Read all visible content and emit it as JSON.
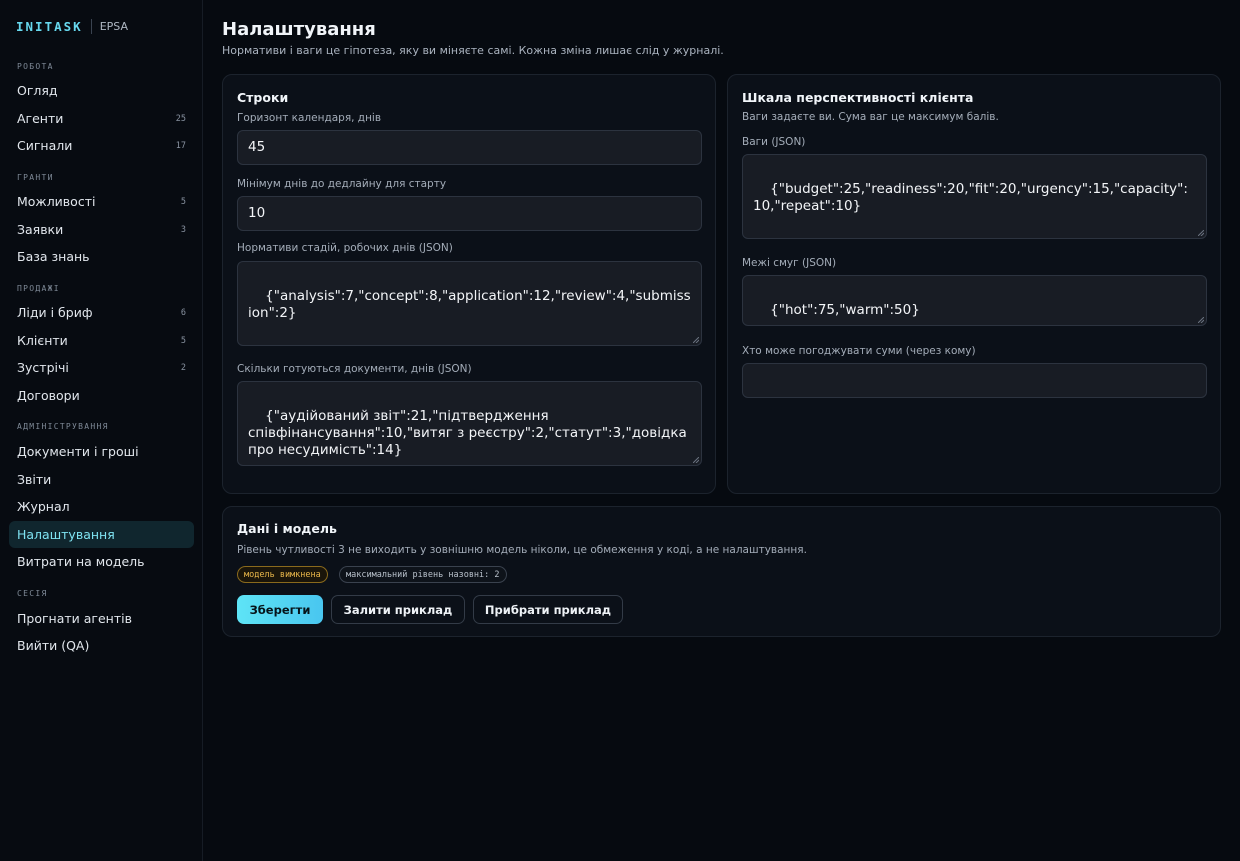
{
  "app": {
    "brand": "INITASK",
    "org": "EPSA"
  },
  "sidebar": {
    "sections": [
      {
        "label": "РОБОТА"
      },
      {
        "label": "ГРАНТИ"
      },
      {
        "label": "ПРОДАЖІ"
      },
      {
        "label": "АДМІНІСТРУВАННЯ"
      },
      {
        "label": "СЕСІЯ"
      }
    ],
    "items": [
      {
        "label": "Огляд",
        "count": ""
      },
      {
        "label": "Агенти",
        "count": "25"
      },
      {
        "label": "Сигнали",
        "count": "17"
      },
      {
        "label": "Можливості",
        "count": "5"
      },
      {
        "label": "Заявки",
        "count": "3"
      },
      {
        "label": "База знань",
        "count": ""
      },
      {
        "label": "Ліди і бриф",
        "count": "6"
      },
      {
        "label": "Клієнти",
        "count": "5"
      },
      {
        "label": "Зустрічі",
        "count": "2"
      },
      {
        "label": "Договори",
        "count": ""
      },
      {
        "label": "Документи і гроші",
        "count": ""
      },
      {
        "label": "Звіти",
        "count": ""
      },
      {
        "label": "Журнал",
        "count": ""
      },
      {
        "label": "Налаштування",
        "count": "",
        "active": true
      },
      {
        "label": "Витрати на модель",
        "count": ""
      },
      {
        "label": "Прогнати агентів",
        "count": ""
      },
      {
        "label": "Вийти (QA)",
        "count": ""
      }
    ]
  },
  "page": {
    "title": "Налаштування",
    "subtitle": "Нормативи і ваги це гіпотеза, яку ви міняєте самі. Кожна зміна лишає слід у журналі."
  },
  "deadlines": {
    "title": "Строки",
    "horizon_label": "Горизонт календаря, днів",
    "horizon_value": "45",
    "min_days_label": "Мінімум днів до дедлайну для старту",
    "min_days_value": "10",
    "stages_label": "Нормативи стадій, робочих днів (JSON)",
    "stages_value": "{\"analysis\":7,\"concept\":8,\"application\":12,\"review\":4,\"submission\":2}",
    "docs_label": "Скільки готуються документи, днів (JSON)",
    "docs_value": "{\"аудійований звіт\":21,\"підтвердження співфінансування\":10,\"витяг з реєстру\":2,\"статут\":3,\"довідка про несудимість\":14}"
  },
  "scoring": {
    "title": "Шкала перспективності клієнта",
    "description": "Ваги задаєте ви. Сума ваг це максимум балів.",
    "weights_label": "Ваги (JSON)",
    "weights_value": "{\"budget\":25,\"readiness\":20,\"fit\":20,\"urgency\":15,\"capacity\":10,\"repeat\":10}",
    "bands_label": "Межі смуг (JSON)",
    "bands_value": "{\"hot\":75,\"warm\":50}",
    "approvers_label": "Хто може погоджувати суми (через кому)",
    "approvers_value": ""
  },
  "model": {
    "title": "Дані і модель",
    "description": "Рівень чутливості 3 не виходить у зовнішню модель ніколи, це обмеження у коді, а не налаштування.",
    "badge_status": "модель вимкнена",
    "badge_level": "максимальний рівень назовні: 2",
    "save_label": "Зберегти",
    "fill_label": "Залити приклад",
    "clear_label": "Прибрати приклад"
  },
  "colors": {
    "accent": "#5ee4f6",
    "warning": "#e8b64a",
    "background": "#060a10"
  }
}
